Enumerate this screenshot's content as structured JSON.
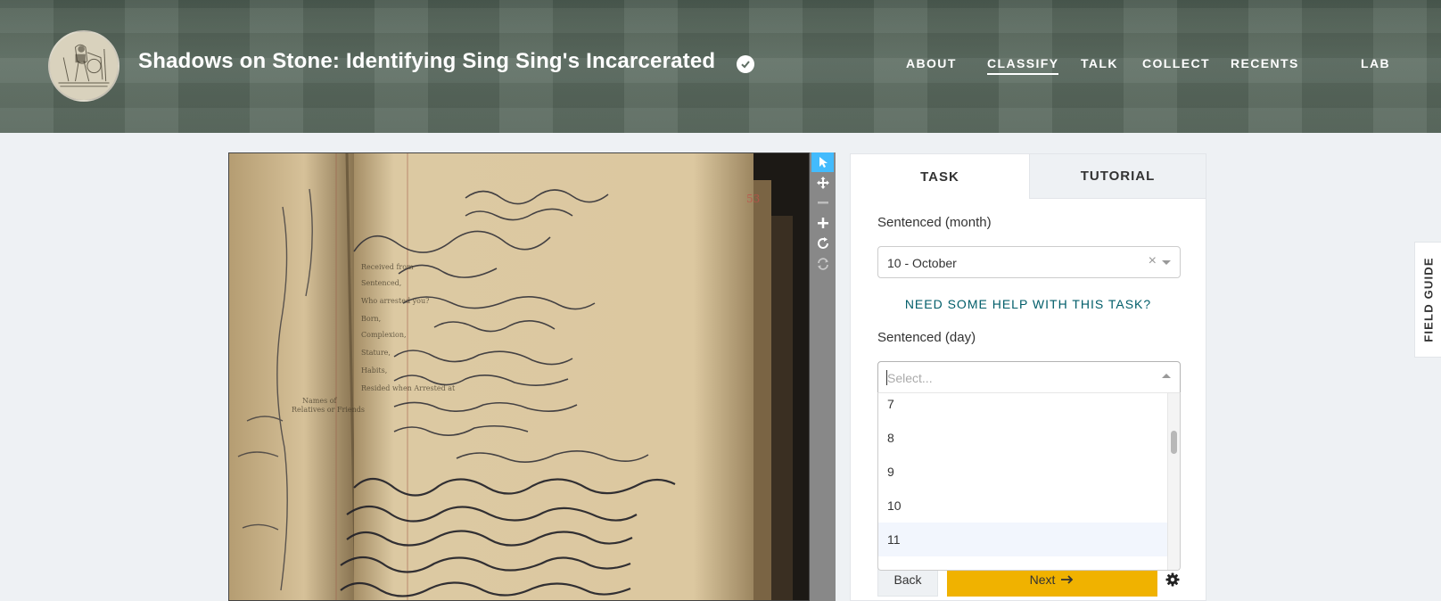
{
  "header": {
    "project_title": "Shadows on Stone: Identifying Sing Sing's Incarcerated",
    "nav": [
      {
        "label": "ABOUT",
        "active": false
      },
      {
        "label": "CLASSIFY",
        "active": true
      },
      {
        "label": "TALK",
        "active": false
      },
      {
        "label": "COLLECT",
        "active": false
      },
      {
        "label": "RECENTS",
        "active": false
      },
      {
        "label": "LAB",
        "active": false
      }
    ]
  },
  "viewer": {
    "page_number": "53",
    "tools": [
      "pointer-icon",
      "move-icon",
      "zoom-out-icon",
      "zoom-in-icon",
      "rotate-icon",
      "reset-icon"
    ]
  },
  "task_panel": {
    "tabs": {
      "task": "TASK",
      "tutorial": "TUTORIAL"
    },
    "month_label": "Sentenced (month)",
    "month_value": "10 - October",
    "help_link": "NEED SOME HELP WITH THIS TASK?",
    "day_label": "Sentenced (day)",
    "day_placeholder": "Select...",
    "day_options": [
      "7",
      "8",
      "9",
      "10",
      "11"
    ],
    "focused_option": "11",
    "back_label": "Back",
    "next_label": "Next"
  },
  "field_guide_label": "FIELD GUIDE",
  "colors": {
    "accent_teal": "#005d69",
    "next_button": "#f0b200",
    "active_tool": "#43bbfd"
  }
}
